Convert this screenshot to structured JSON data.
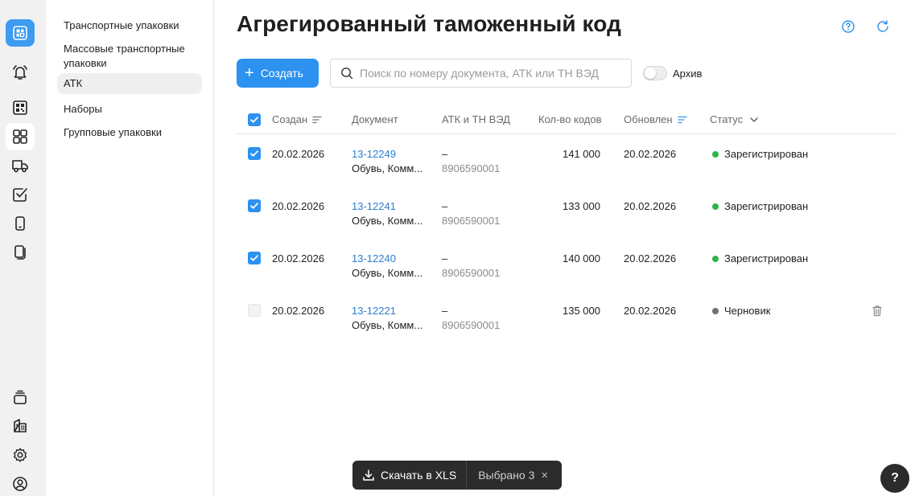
{
  "subnav": {
    "items": [
      {
        "label": "Транспортные упаковки"
      },
      {
        "label": "Массовые транспортные упаковки"
      },
      {
        "label": "АТК"
      },
      {
        "label": "Наборы"
      },
      {
        "label": "Групповые упаковки"
      }
    ],
    "active": "АТК"
  },
  "page": {
    "title": "Агрегированный таможенный код"
  },
  "toolbar": {
    "create_label": "Создать",
    "search_placeholder": "Поиск по номеру документа, АТК или ТН ВЭД",
    "search_value": "",
    "archive_label": "Архив",
    "archive_on": false
  },
  "table": {
    "columns": [
      "Создан",
      "Документ",
      "АТК и ТН ВЭД",
      "Кол-во кодов",
      "Обновлен",
      "Статус"
    ],
    "rows": [
      {
        "checked": true,
        "created": "20.02.2026",
        "doc_number": "13-12249",
        "doc_desc": "Обувь, Комм...",
        "atk": "–",
        "tnved": "8906590001",
        "count": "141 000",
        "updated": "20.02.2026",
        "status": "Зарегистрирован",
        "status_color": "#2fb34a"
      },
      {
        "checked": true,
        "created": "20.02.2026",
        "doc_number": "13-12241",
        "doc_desc": "Обувь, Комм...",
        "atk": "–",
        "tnved": "8906590001",
        "count": "133 000",
        "updated": "20.02.2026",
        "status": "Зарегистрирован",
        "status_color": "#2fb34a"
      },
      {
        "checked": true,
        "created": "20.02.2026",
        "doc_number": "13-12240",
        "doc_desc": "Обувь, Комм...",
        "atk": "–",
        "tnved": "8906590001",
        "count": "140 000",
        "updated": "20.02.2026",
        "status": "Зарегистрирован",
        "status_color": "#2fb34a"
      },
      {
        "checked": false,
        "created": "20.02.2026",
        "doc_number": "13-12221",
        "doc_desc": "Обувь, Комм...",
        "atk": "–",
        "tnved": "8906590001",
        "count": "135 000",
        "updated": "20.02.2026",
        "status": "Черновик",
        "status_color": "#6f6f6f"
      }
    ]
  },
  "bottom_bar": {
    "download_label": "Скачать в XLS",
    "selected_label": "Выбрано 3",
    "close": "×"
  },
  "help": {
    "label": "?"
  },
  "colors": {
    "accent": "#2c91ef",
    "link": "#2c7dcf",
    "success": "#2fb34a",
    "draft": "#6f6f6f"
  }
}
